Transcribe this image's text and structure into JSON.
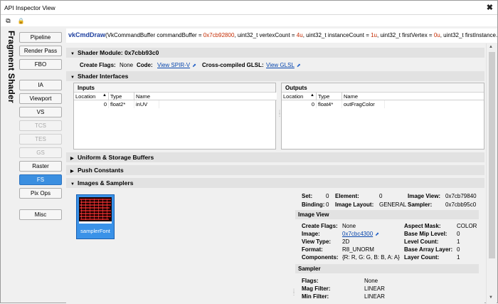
{
  "window": {
    "title": "API Inspector View",
    "close_glyph": "✖"
  },
  "toolbar": {
    "icons": [
      "copy-icon",
      "lock-icon"
    ],
    "copy_glyph": "⧉",
    "lock_glyph": "🔒"
  },
  "pipeline": {
    "vertical_title": "Fragment Shader",
    "top_stages": [
      {
        "label": "Pipeline",
        "state": "normal"
      },
      {
        "label": "Render Pass",
        "state": "normal"
      },
      {
        "label": "FBO",
        "state": "normal"
      }
    ],
    "stages": [
      {
        "label": "IA",
        "state": "normal"
      },
      {
        "label": "Viewport",
        "state": "normal"
      },
      {
        "label": "VS",
        "state": "normal"
      },
      {
        "label": "TCS",
        "state": "disabled"
      },
      {
        "label": "TES",
        "state": "disabled"
      },
      {
        "label": "GS",
        "state": "disabled"
      },
      {
        "label": "Raster",
        "state": "normal"
      },
      {
        "label": "FS",
        "state": "selected"
      },
      {
        "label": "Pix Ops",
        "state": "normal"
      }
    ],
    "misc": {
      "label": "Misc",
      "state": "normal"
    }
  },
  "call": {
    "name": "vkCmdDraw",
    "text_open": "(VkCommandBuffer commandBuffer = ",
    "command_buffer": "0x7cb92800",
    "vertex_count_label": ", uint32_t vertexCount = ",
    "vertex_count": "4u",
    "instance_count_label": ", uint32_t instanceCount = ",
    "instance_count": "1u",
    "first_vertex_label": ", uint32_t firstVertex = ",
    "first_vertex": "0u",
    "tail": ", uint32_t firstInstance..."
  },
  "shader_module": {
    "header": "Shader Module: 0x7cbb93c0",
    "create_flags_label": "Create Flags:",
    "create_flags": "None",
    "code_label": "Code:",
    "code_link": "View SPIR-V",
    "glsl_label": "Cross-compiled GLSL:",
    "glsl_link": "View GLSL"
  },
  "interfaces": {
    "header": "Shader Interfaces",
    "inputs": {
      "title": "Inputs",
      "columns": [
        "Location",
        "Type",
        "Name"
      ],
      "rows": [
        {
          "location": "0",
          "type": "float2*",
          "name": "inUV"
        }
      ]
    },
    "outputs": {
      "title": "Outputs",
      "columns": [
        "Location",
        "Type",
        "Name"
      ],
      "rows": [
        {
          "location": "0",
          "type": "float4*",
          "name": "outFragColor"
        }
      ]
    }
  },
  "sections": {
    "uniform": "Uniform & Storage Buffers",
    "push": "Push Constants",
    "images": "Images & Samplers"
  },
  "sampler_item": {
    "caption": "samplerFont"
  },
  "binding_info": {
    "set_label": "Set:",
    "set": "0",
    "element_label": "Element:",
    "element": "0",
    "image_view_label": "Image View:",
    "image_view": "0x7cb79840",
    "binding_label": "Binding:",
    "binding": "0",
    "image_layout_label": "Image Layout:",
    "image_layout": "GENERAL",
    "sampler_label": "Sampler:",
    "sampler": "0x7cbb95c0"
  },
  "image_view": {
    "header": "Image View",
    "create_flags_label": "Create Flags:",
    "create_flags": "None",
    "image_label": "Image:",
    "image": "0x7cbc4300",
    "view_type_label": "View Type:",
    "view_type": "2D",
    "format_label": "Format:",
    "format": "R8_UNORM",
    "components_label": "Components:",
    "components": "{R: R, G: G, B: B, A: A}",
    "aspect_mask_label": "Aspect Mask:",
    "aspect_mask": "COLOR",
    "base_mip_label": "Base Mip Level:",
    "base_mip": "0",
    "level_count_label": "Level Count:",
    "level_count": "1",
    "base_array_label": "Base Array Layer:",
    "base_array": "0",
    "layer_count_label": "Layer Count:",
    "layer_count": "1"
  },
  "sampler": {
    "header": "Sampler",
    "flags_label": "Flags:",
    "flags": "None",
    "mag_filter_label": "Mag Filter:",
    "mag_filter": "LINEAR",
    "min_filter_label": "Min Filter:",
    "min_filter": "LINEAR"
  },
  "colors": {
    "accent": "#3b8fe0",
    "call_name": "#1d3f9f",
    "param_value": "#c42a00"
  }
}
